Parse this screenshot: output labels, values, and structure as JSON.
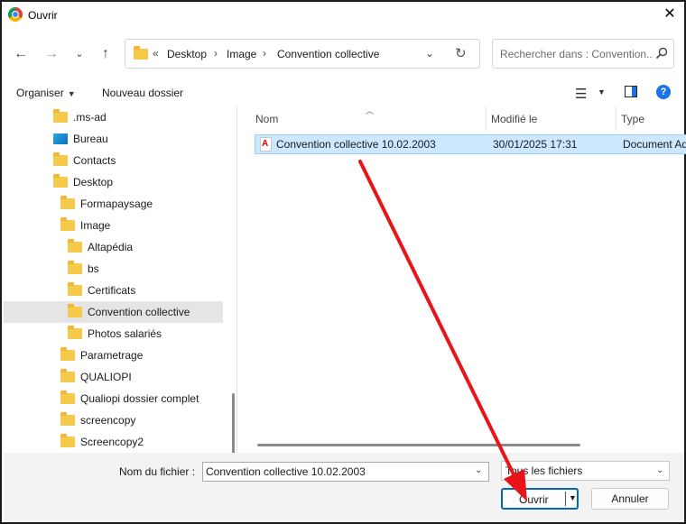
{
  "window": {
    "title": "Ouvrir"
  },
  "address": {
    "separator": "«",
    "crumbs": [
      "Desktop",
      "Image",
      "Convention collective"
    ]
  },
  "search": {
    "placeholder": "Rechercher dans : Convention..."
  },
  "toolbar": {
    "organize": "Organiser",
    "new_folder": "Nouveau dossier"
  },
  "tree": {
    "items": [
      {
        "label": ".ms-ad",
        "icon": "folder-icon"
      },
      {
        "label": "Bureau",
        "icon": "desktop-icon"
      },
      {
        "label": "Contacts",
        "icon": "folder-icon"
      },
      {
        "label": "Desktop",
        "icon": "folder-icon"
      },
      {
        "label": "Formapaysage",
        "icon": "folder-icon"
      },
      {
        "label": "Image",
        "icon": "folder-icon"
      },
      {
        "label": "Altapédia",
        "icon": "folder-icon"
      },
      {
        "label": "bs",
        "icon": "folder-icon"
      },
      {
        "label": "Certificats",
        "icon": "folder-icon"
      },
      {
        "label": "Convention collective",
        "icon": "folder-icon",
        "selected": true
      },
      {
        "label": "Photos salariés",
        "icon": "folder-icon"
      },
      {
        "label": "Parametrage",
        "icon": "folder-icon"
      },
      {
        "label": "QUALIOPI",
        "icon": "folder-icon"
      },
      {
        "label": "Qualiopi dossier complet",
        "icon": "folder-icon"
      },
      {
        "label": "screencopy",
        "icon": "folder-icon"
      },
      {
        "label": "Screencopy2",
        "icon": "folder-icon"
      }
    ]
  },
  "files": {
    "columns": [
      "Nom",
      "Modifié le",
      "Type"
    ],
    "rows": [
      {
        "name": "Convention collective 10.02.2003",
        "modified": "30/01/2025 17:31",
        "type": "Document Ad",
        "icon": "pdf-icon"
      }
    ]
  },
  "bottom": {
    "filename_label": "Nom du fichier :",
    "filename_value": "Convention collective 10.02.2003",
    "filetype": "Tous les fichiers",
    "open_label": "Ouvrir",
    "cancel_label": "Annuler"
  },
  "annotation": {
    "arrow_color": "#e8141a"
  }
}
